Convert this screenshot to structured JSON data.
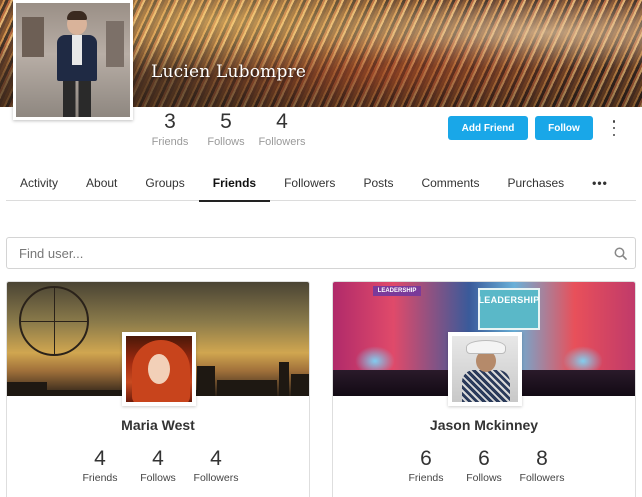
{
  "profile": {
    "name": "Lucien Lubompre",
    "stats": [
      {
        "value": "3",
        "label": "Friends"
      },
      {
        "value": "5",
        "label": "Follows"
      },
      {
        "value": "4",
        "label": "Followers"
      }
    ],
    "actions": {
      "add_friend": "Add Friend",
      "follow": "Follow"
    },
    "more_icon": "vertical-ellipsis-icon"
  },
  "tabs": [
    {
      "label": "Activity",
      "active": false
    },
    {
      "label": "About",
      "active": false
    },
    {
      "label": "Groups",
      "active": false
    },
    {
      "label": "Friends",
      "active": true
    },
    {
      "label": "Followers",
      "active": false
    },
    {
      "label": "Posts",
      "active": false
    },
    {
      "label": "Comments",
      "active": false
    },
    {
      "label": "Purchases",
      "active": false
    },
    {
      "label": "•••",
      "active": false
    }
  ],
  "search": {
    "placeholder": "Find user...",
    "value": "",
    "icon": "search-icon"
  },
  "friends": [
    {
      "name": "Maria West",
      "stats": [
        {
          "value": "4",
          "label": "Friends"
        },
        {
          "value": "4",
          "label": "Follows"
        },
        {
          "value": "4",
          "label": "Followers"
        }
      ]
    },
    {
      "name": "Jason Mckinney",
      "cover_text": "LEADERSHIP",
      "stats": [
        {
          "value": "6",
          "label": "Friends"
        },
        {
          "value": "6",
          "label": "Follows"
        },
        {
          "value": "8",
          "label": "Followers"
        }
      ]
    }
  ],
  "colors": {
    "accent": "#19a7e8",
    "active_tab_underline": "#222222"
  }
}
